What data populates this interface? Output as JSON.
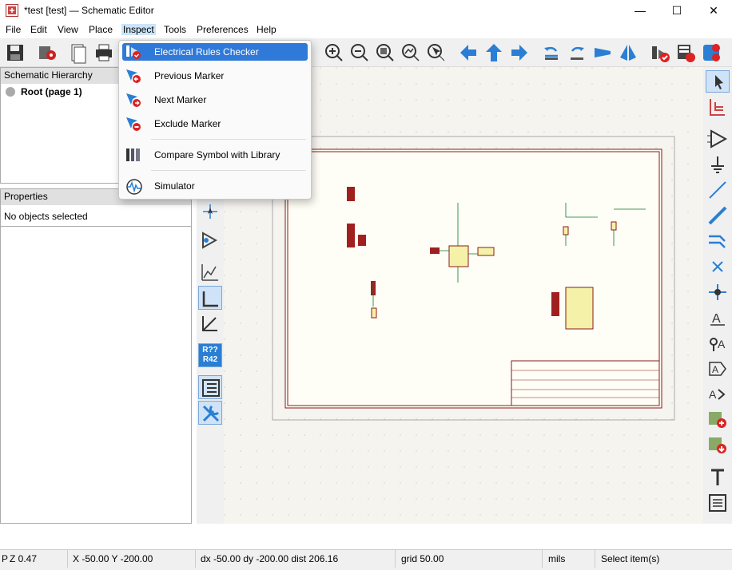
{
  "window": {
    "title": "*test [test] — Schematic Editor",
    "minimize": "—",
    "maximize": "☐",
    "close": "✕"
  },
  "menu": [
    "File",
    "Edit",
    "View",
    "Place",
    "Inspect",
    "Tools",
    "Preferences",
    "Help"
  ],
  "hierarchy": {
    "title": "Schematic Hierarchy",
    "root": "Root (page 1)"
  },
  "properties": {
    "title": "Properties",
    "empty": "No objects selected"
  },
  "dropdown": {
    "items": [
      {
        "label": "Electrical Rules Checker",
        "icon": "erc-icon"
      },
      {
        "label": "Previous Marker",
        "icon": "previous-marker-icon"
      },
      {
        "label": "Next Marker",
        "icon": "next-marker-icon"
      },
      {
        "label": "Exclude Marker",
        "icon": "exclude-marker-icon"
      },
      {
        "label": "Compare Symbol with Library",
        "icon": "compare-symbol-icon"
      },
      {
        "label": "Simulator",
        "icon": "simulator-icon"
      }
    ]
  },
  "lefttool": {
    "annotate": "R??",
    "annotate2": "R42"
  },
  "status": {
    "zoom": "Z 0.47",
    "prefix": "P",
    "coords": "X -50.00  Y -200.00",
    "delta": "dx -50.00  dy -200.00  dist 206.16",
    "grid": "grid 50.00",
    "units": "mils",
    "mode": "Select item(s)"
  }
}
